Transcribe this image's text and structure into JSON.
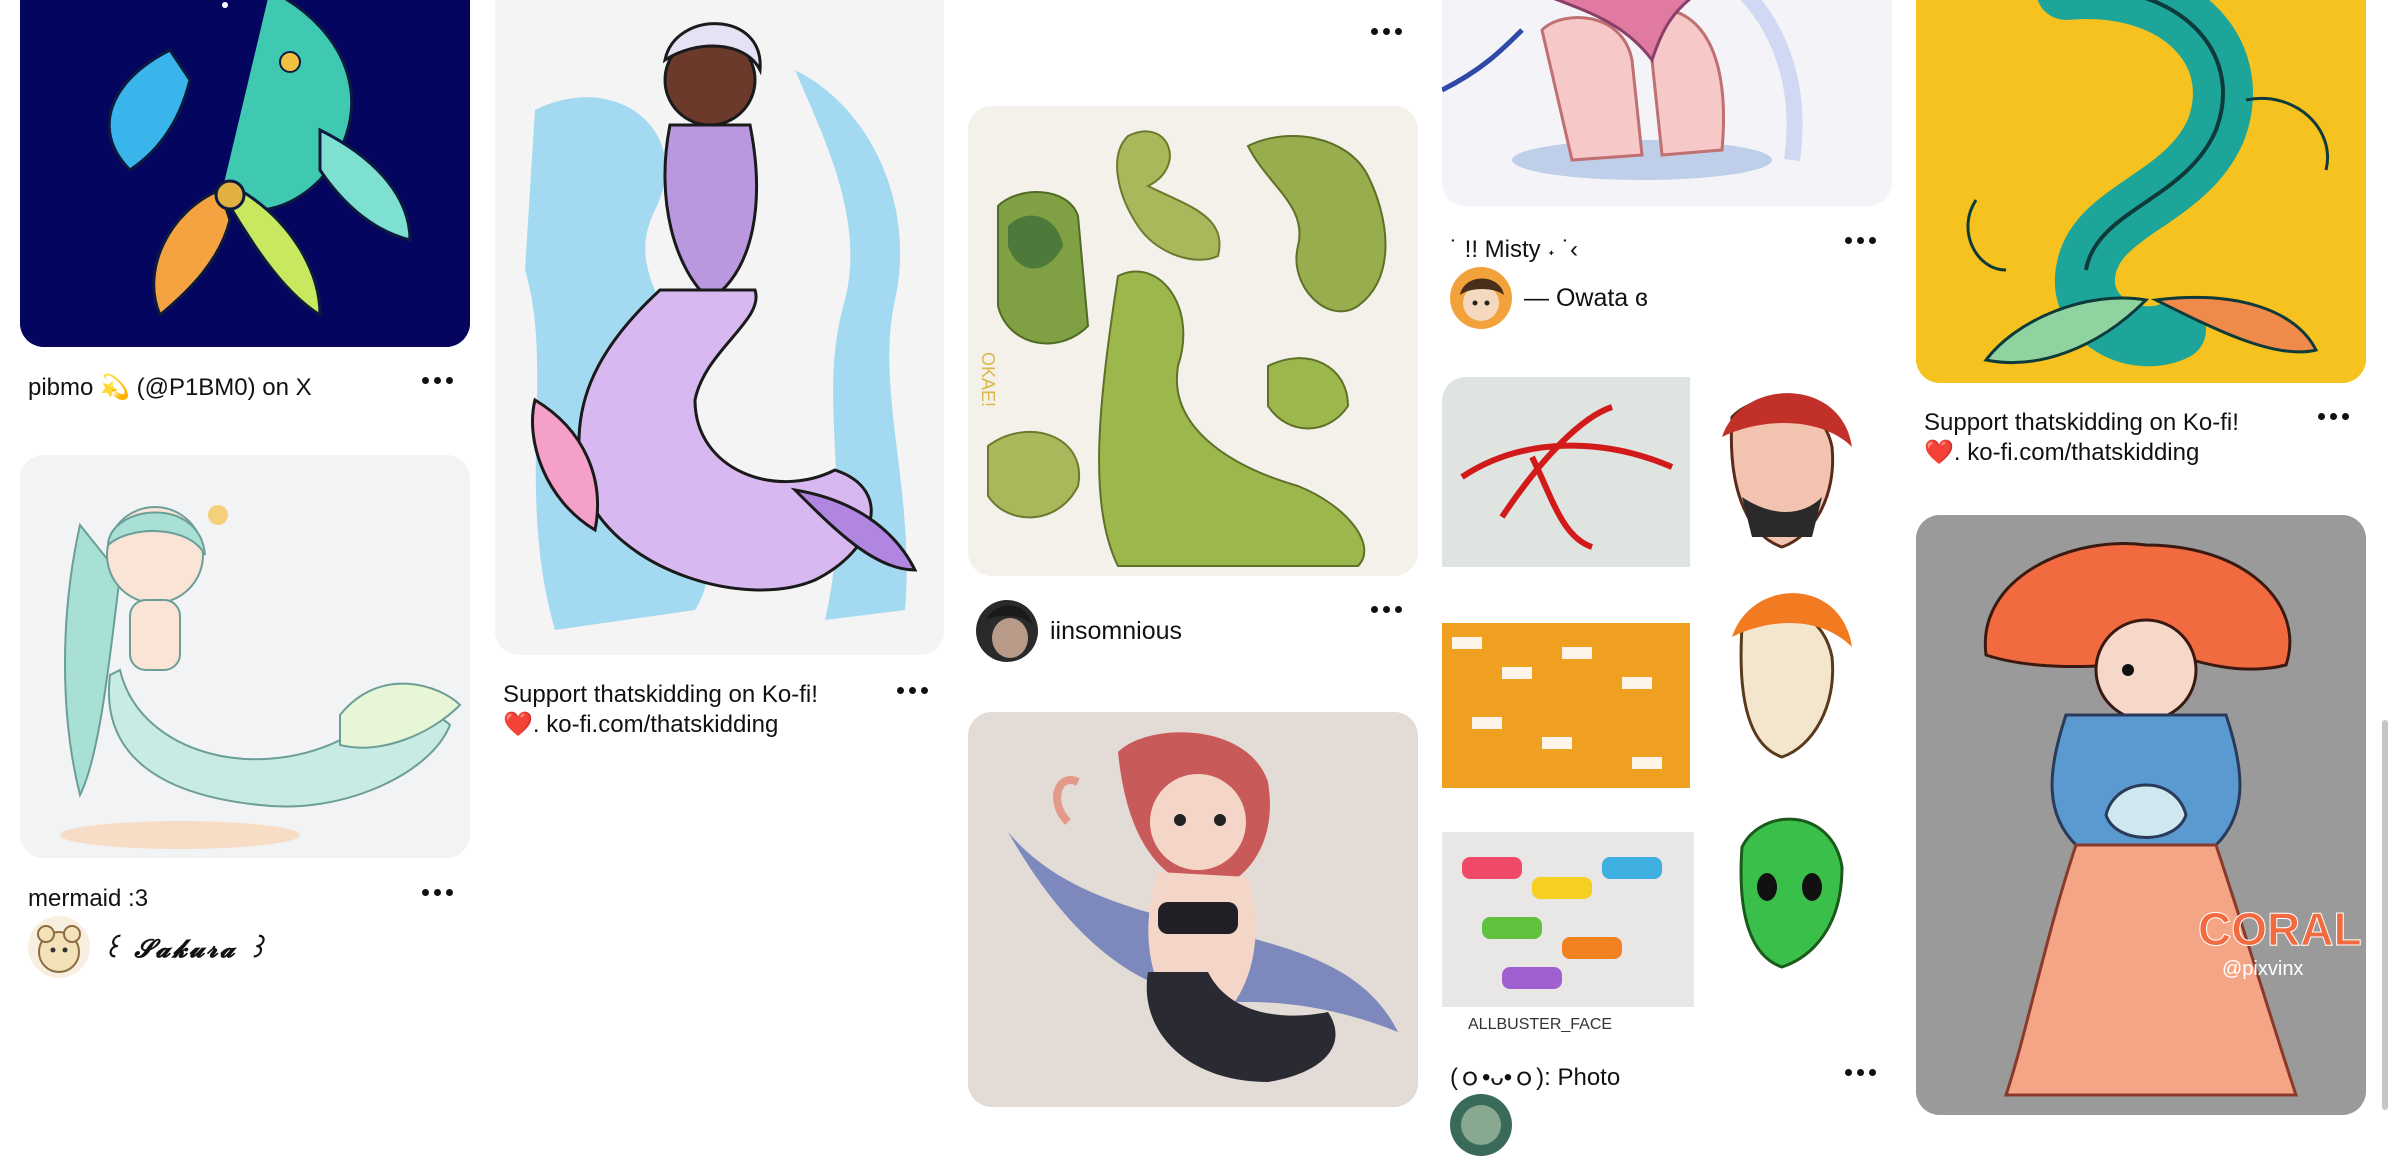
{
  "pins": [
    {
      "title": "pibmo 💫 (@P1BM0) on X"
    },
    {
      "title": "mermaid :3",
      "author": "꒰ 𝓢𝓪𝓴𝓾𝓻𝓪 ꒱"
    },
    {
      "title_line1": "Support thatskidding on Ko-fi!",
      "title_line2": "❤️. ko-fi.com/thatskidding"
    },
    {
      "author": "iinsomnious"
    },
    {
      "title": "˙ !! Misty ˖ ˙‹",
      "author": "— Owata ɞ"
    },
    {
      "title": "(ｏ•ᴗ•ｏ): Photo"
    },
    {
      "title_line1": "Support thatskidding on Ko-fi!",
      "title_line2": "❤️. ko-fi.com/thatskidding"
    }
  ],
  "overlay_text": {
    "okae": "OKAE!",
    "coral": "CORAL",
    "pixvinx": "@pixvinx",
    "signature": "ALLBUSTER_FACE"
  },
  "colors": {
    "text": "#111111",
    "navy_bg": "#04055e",
    "yellow_bg": "#f5c21f",
    "gray_bg": "#9a9a9a"
  }
}
